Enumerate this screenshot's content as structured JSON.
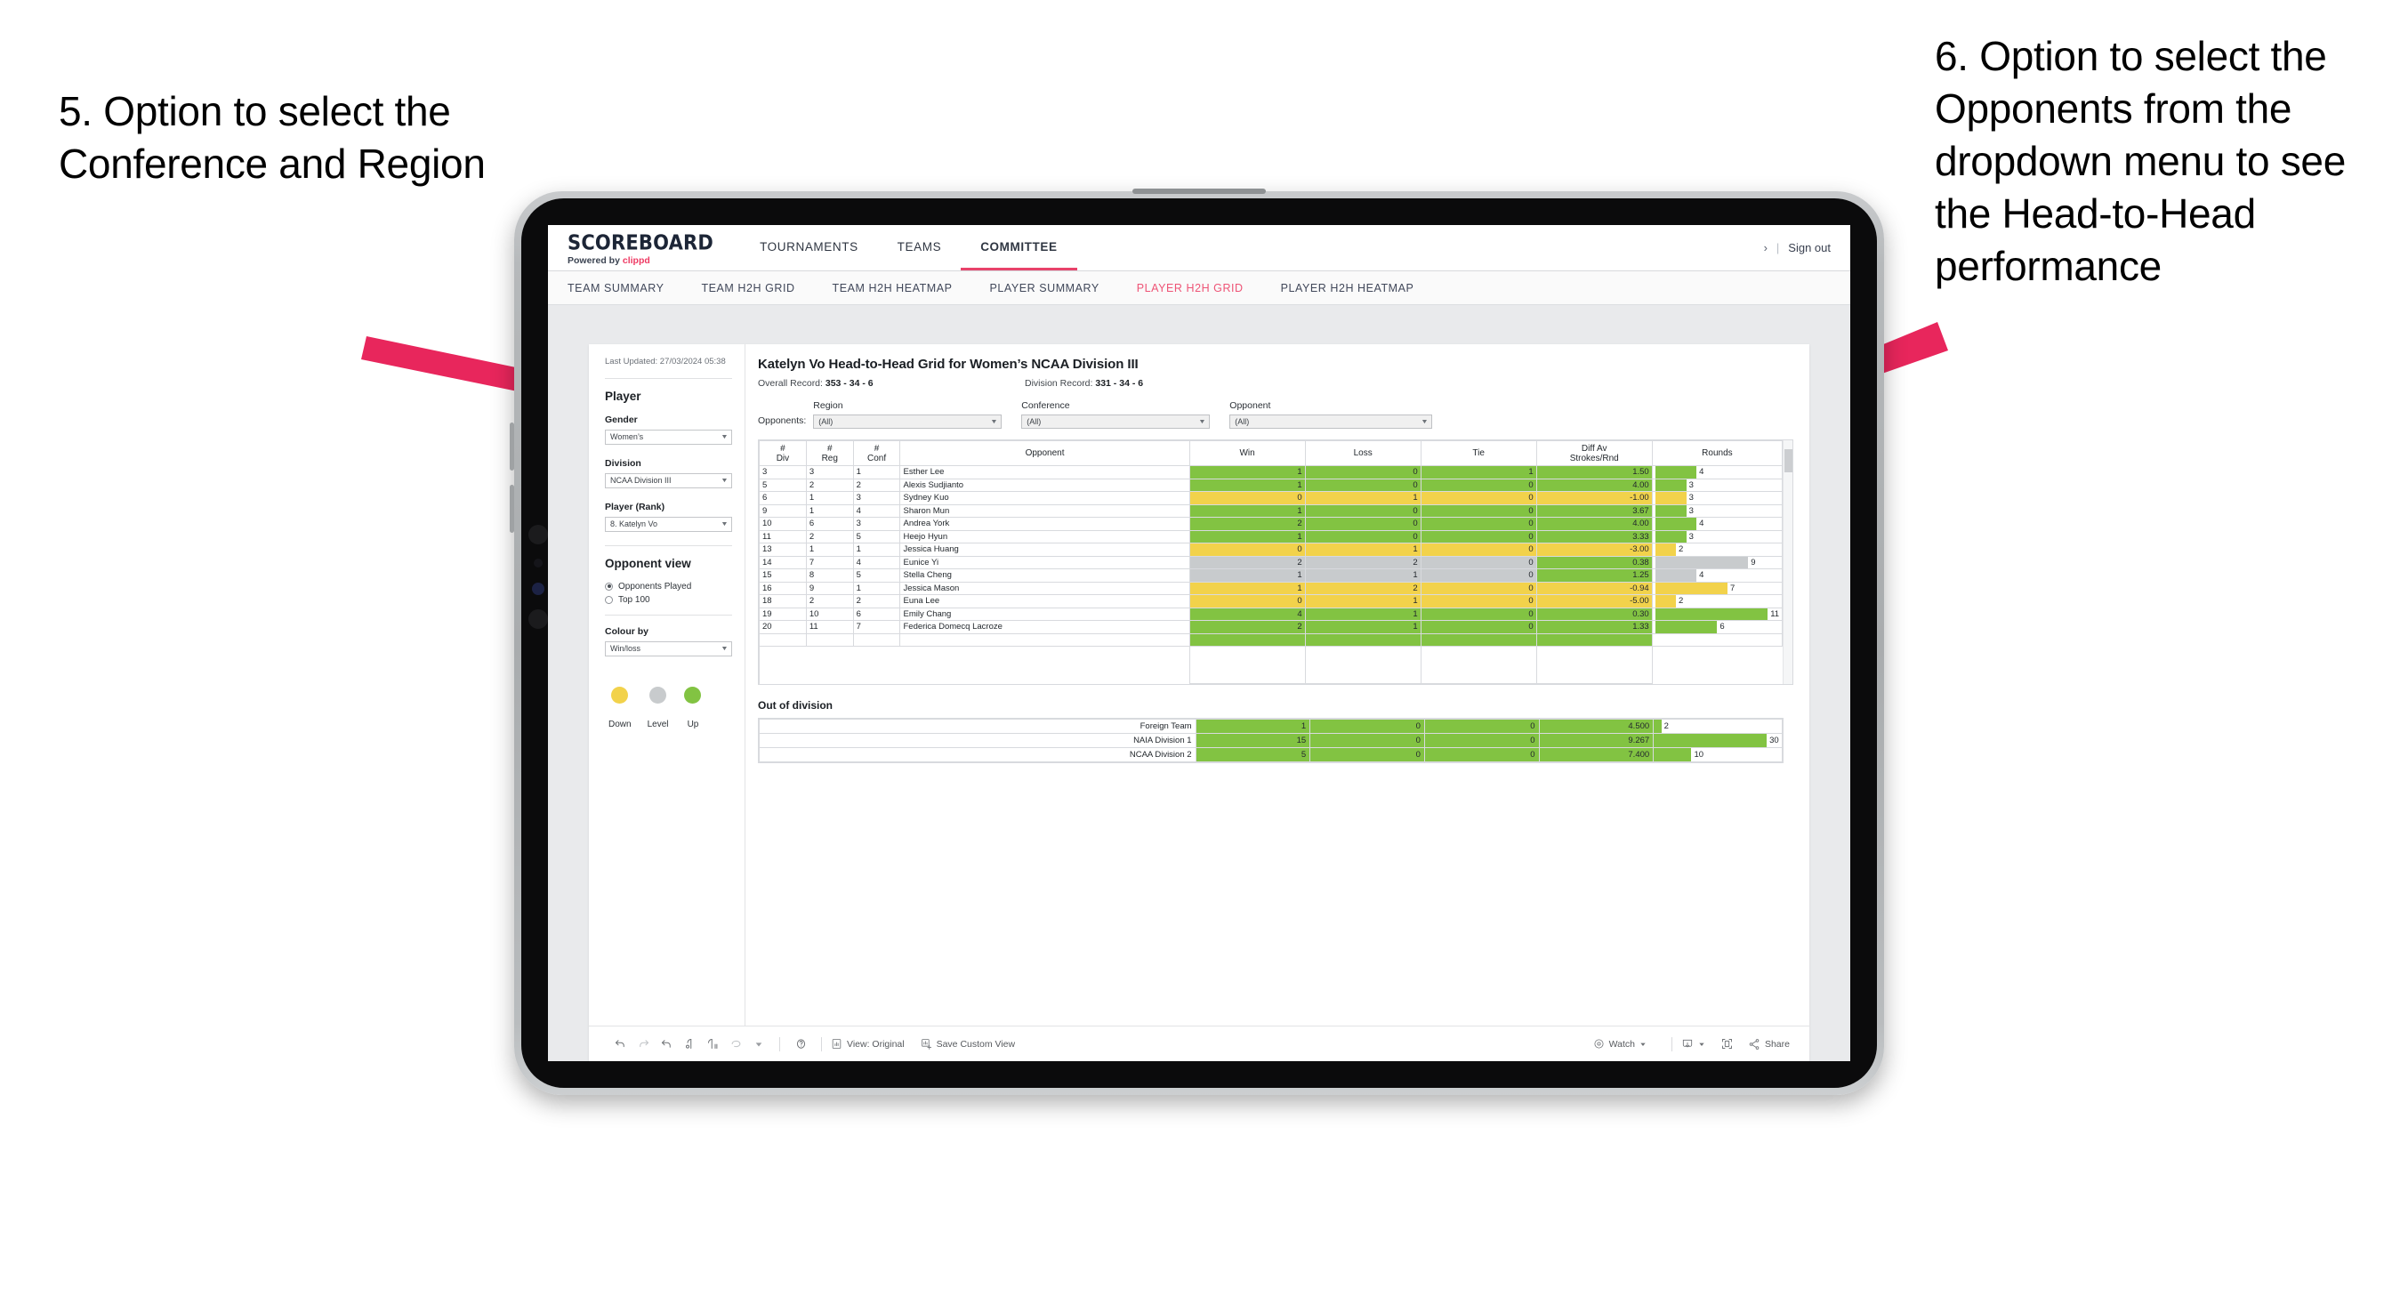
{
  "annotations": {
    "left": "5. Option to select the Conference and Region",
    "right": "6. Option to select the Opponents from the dropdown menu to see the Head-to-Head performance",
    "arrow_color": "#E8265C"
  },
  "app": {
    "logo": {
      "title": "SCOREBOARD",
      "powered_prefix": "Powered by ",
      "brand": "clippd"
    },
    "main_nav": [
      {
        "label": "TOURNAMENTS",
        "active": false
      },
      {
        "label": "TEAMS",
        "active": false
      },
      {
        "label": "COMMITTEE",
        "active": true
      }
    ],
    "topbar_right": {
      "chevron": "›",
      "separator": "|",
      "sign_out": "Sign out"
    },
    "sub_nav": [
      {
        "label": "TEAM SUMMARY",
        "active": false
      },
      {
        "label": "TEAM H2H GRID",
        "active": false
      },
      {
        "label": "TEAM H2H HEATMAP",
        "active": false
      },
      {
        "label": "PLAYER SUMMARY",
        "active": false
      },
      {
        "label": "PLAYER H2H GRID",
        "active": true
      },
      {
        "label": "PLAYER H2H HEATMAP",
        "active": false
      }
    ]
  },
  "sidebar": {
    "last_updated": "Last Updated: 27/03/2024 05:38",
    "section_player": "Player",
    "gender": {
      "label": "Gender",
      "value": "Women’s"
    },
    "division": {
      "label": "Division",
      "value": "NCAA Division III"
    },
    "player_rank": {
      "label": "Player (Rank)",
      "value": "8. Katelyn Vo"
    },
    "opponent_view": {
      "title": "Opponent view",
      "options": [
        {
          "label": "Opponents Played",
          "selected": true
        },
        {
          "label": "Top 100",
          "selected": false
        }
      ]
    },
    "colour_by": {
      "label": "Colour by",
      "value": "Win/loss"
    },
    "legend": [
      {
        "label": "Down",
        "color": "#F2D24B"
      },
      {
        "label": "Level",
        "color": "#C8CBCD"
      },
      {
        "label": "Up",
        "color": "#82C342"
      }
    ]
  },
  "main": {
    "title": "Katelyn Vo Head-to-Head Grid for Women’s NCAA Division III",
    "overall_record_label": "Overall Record:",
    "overall_record_value": "353 - 34 - 6",
    "division_record_label": "Division Record:",
    "division_record_value": "331 -  34 - 6",
    "filters_label": "Opponents:",
    "filters": [
      {
        "name": "Region",
        "value": "(All)"
      },
      {
        "name": "Conference",
        "value": "(All)"
      },
      {
        "name": "Opponent",
        "value": "(All)"
      }
    ],
    "columns": [
      "#\nDiv",
      "#\nReg",
      "#\nConf",
      "Opponent",
      "Win",
      "Loss",
      "Tie",
      "Diff Av\nStrokes/Rnd",
      "Rounds"
    ],
    "column_labels": {
      "div": "# Div",
      "reg": "# Reg",
      "conf": "# Conf",
      "opponent": "Opponent",
      "win": "Win",
      "loss": "Loss",
      "tie": "Tie",
      "diff": "Diff Av Strokes/Rnd",
      "rounds": "Rounds"
    },
    "rows": [
      {
        "div": "3",
        "reg": "3",
        "conf": "1",
        "opponent": "Esther Lee",
        "win": "1",
        "loss": "0",
        "tie": "1",
        "diff": "1.50",
        "rounds": "4",
        "status": "up"
      },
      {
        "div": "5",
        "reg": "2",
        "conf": "2",
        "opponent": "Alexis Sudjianto",
        "win": "1",
        "loss": "0",
        "tie": "0",
        "diff": "4.00",
        "rounds": "3",
        "status": "up"
      },
      {
        "div": "6",
        "reg": "1",
        "conf": "3",
        "opponent": "Sydney Kuo",
        "win": "0",
        "loss": "1",
        "tie": "0",
        "diff": "-1.00",
        "rounds": "3",
        "status": "down"
      },
      {
        "div": "9",
        "reg": "1",
        "conf": "4",
        "opponent": "Sharon Mun",
        "win": "1",
        "loss": "0",
        "tie": "0",
        "diff": "3.67",
        "rounds": "3",
        "status": "up"
      },
      {
        "div": "10",
        "reg": "6",
        "conf": "3",
        "opponent": "Andrea York",
        "win": "2",
        "loss": "0",
        "tie": "0",
        "diff": "4.00",
        "rounds": "4",
        "status": "up"
      },
      {
        "div": "11",
        "reg": "2",
        "conf": "5",
        "opponent": "Heejo Hyun",
        "win": "1",
        "loss": "0",
        "tie": "0",
        "diff": "3.33",
        "rounds": "3",
        "status": "up"
      },
      {
        "div": "13",
        "reg": "1",
        "conf": "1",
        "opponent": "Jessica Huang",
        "win": "0",
        "loss": "1",
        "tie": "0",
        "diff": "-3.00",
        "rounds": "2",
        "status": "down"
      },
      {
        "div": "14",
        "reg": "7",
        "conf": "4",
        "opponent": "Eunice Yi",
        "win": "2",
        "loss": "2",
        "tie": "0",
        "diff": "0.38",
        "rounds": "9",
        "status": "level",
        "diff_status": "up"
      },
      {
        "div": "15",
        "reg": "8",
        "conf": "5",
        "opponent": "Stella Cheng",
        "win": "1",
        "loss": "1",
        "tie": "0",
        "diff": "1.25",
        "rounds": "4",
        "status": "level",
        "diff_status": "up"
      },
      {
        "div": "16",
        "reg": "9",
        "conf": "1",
        "opponent": "Jessica Mason",
        "win": "1",
        "loss": "2",
        "tie": "0",
        "diff": "-0.94",
        "rounds": "7",
        "status": "down"
      },
      {
        "div": "18",
        "reg": "2",
        "conf": "2",
        "opponent": "Euna Lee",
        "win": "0",
        "loss": "1",
        "tie": "0",
        "diff": "-5.00",
        "rounds": "2",
        "status": "down"
      },
      {
        "div": "19",
        "reg": "10",
        "conf": "6",
        "opponent": "Emily Chang",
        "win": "4",
        "loss": "1",
        "tie": "0",
        "diff": "0.30",
        "rounds": "11",
        "status": "up"
      },
      {
        "div": "20",
        "reg": "11",
        "conf": "7",
        "opponent": "Federica Domecq Lacroze",
        "win": "2",
        "loss": "1",
        "tie": "0",
        "diff": "1.33",
        "rounds": "6",
        "status": "up"
      }
    ],
    "out_of_division": {
      "title": "Out of division",
      "rows": [
        {
          "name": "Foreign Team",
          "win": "1",
          "loss": "0",
          "tie": "0",
          "diff": "4.500",
          "rounds": "2",
          "status": "up"
        },
        {
          "name": "NAIA Division 1",
          "win": "15",
          "loss": "0",
          "tie": "0",
          "diff": "9.267",
          "rounds": "30",
          "status": "up"
        },
        {
          "name": "NCAA Division 2",
          "win": "5",
          "loss": "0",
          "tie": "0",
          "diff": "7.400",
          "rounds": "10",
          "status": "up"
        }
      ]
    }
  },
  "toolbar": {
    "icons": [
      "undo-icon",
      "redo-icon",
      "revert-icon",
      "refresh-icon",
      "pause-icon",
      "reset-icon",
      "chevron-down-icon",
      "help-icon"
    ],
    "view_original": "View: Original",
    "save_custom_view": "Save Custom View",
    "watch": "Watch",
    "share": "Share"
  },
  "colors": {
    "up": "#82C342",
    "down": "#F2D24B",
    "level": "#C8CBCD",
    "accent": "#EE3A63",
    "accent_tab": "#EE5476"
  }
}
